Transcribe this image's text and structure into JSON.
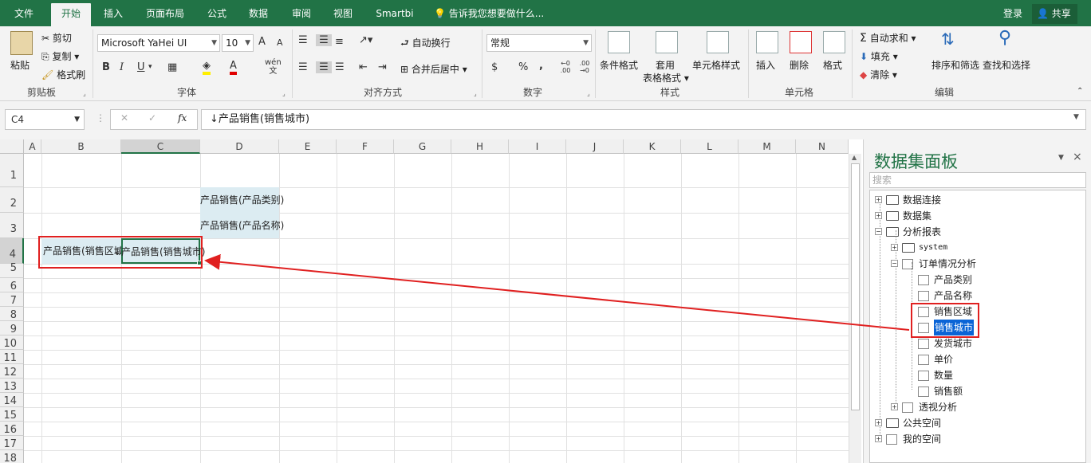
{
  "tabs": {
    "file": "文件",
    "home": "开始",
    "insert": "插入",
    "layout": "页面布局",
    "formulas": "公式",
    "data": "数据",
    "review": "审阅",
    "view": "视图",
    "smartbi": "Smartbi",
    "tell": "告诉我您想要做什么..."
  },
  "account": {
    "login": "登录",
    "share": "共享"
  },
  "ribbon": {
    "clipboard": {
      "label": "剪贴板",
      "paste": "粘贴",
      "cut": "剪切",
      "copy": "复制",
      "format_painter": "格式刷"
    },
    "font": {
      "label": "字体",
      "name": "Microsoft YaHei UI",
      "size": "10",
      "grow": "A",
      "shrink": "A",
      "bold": "B",
      "italic": "I",
      "underline": "U",
      "wen": "wén",
      "wen_char": "文"
    },
    "alignment": {
      "label": "对齐方式",
      "wrap": "自动换行",
      "merge": "合并后居中"
    },
    "number": {
      "label": "数字",
      "format": "常规",
      "currency": "$",
      "percent": "%",
      "comma": ",",
      "inc": "←0 .00",
      "dec": ".00 →0"
    },
    "styles": {
      "label": "样式",
      "conditional": "条件格式",
      "table1": "套用",
      "table2": "表格格式",
      "cell_styles": "单元格样式"
    },
    "cells": {
      "label": "单元格",
      "insert": "插入",
      "delete": "删除",
      "format": "格式"
    },
    "editing": {
      "label": "编辑",
      "autosum": "自动求和",
      "fill": "填充",
      "clear": "清除",
      "sort": "排序和筛选",
      "find": "查找和选择"
    }
  },
  "formula_bar": {
    "name_box": "C4",
    "cancel": "✕",
    "enter": "✓",
    "fx": "fx",
    "content": "↓产品销售(销售城市)"
  },
  "sheet": {
    "columns": [
      "A",
      "B",
      "C",
      "D",
      "E",
      "F",
      "G",
      "H",
      "I",
      "J",
      "K",
      "L",
      "M",
      "N"
    ],
    "rows": [
      "1",
      "2",
      "3",
      "4",
      "5",
      "6",
      "7",
      "8",
      "9",
      "10",
      "11",
      "12",
      "13",
      "14",
      "15",
      "16",
      "17",
      "18"
    ],
    "cells": {
      "D2": "产品销售(产品类别)",
      "D3": "产品销售(产品名称)",
      "B4": "↓产品销售(销售区域)",
      "C4": "↓产品销售(销售城市)"
    }
  },
  "panel": {
    "title": "数据集面板",
    "close": "×",
    "search_placeholder": "搜索",
    "tree": {
      "data_connect": "数据连接",
      "dataset": "数据集",
      "analysis_report": "分析报表",
      "system": "system",
      "order_analysis": "订单情况分析",
      "fields": [
        "产品类别",
        "产品名称",
        "销售区域",
        "销售城市",
        "发货城市",
        "单价",
        "数量",
        "销售额"
      ],
      "pivot": "透视分析",
      "public_space": "公共空间",
      "my_space": "我的空间"
    }
  },
  "colors": {
    "accent": "#217346",
    "selection": "#0a64d6",
    "annotation": "#e02020",
    "field_cell_bg": "#dcecf2"
  }
}
